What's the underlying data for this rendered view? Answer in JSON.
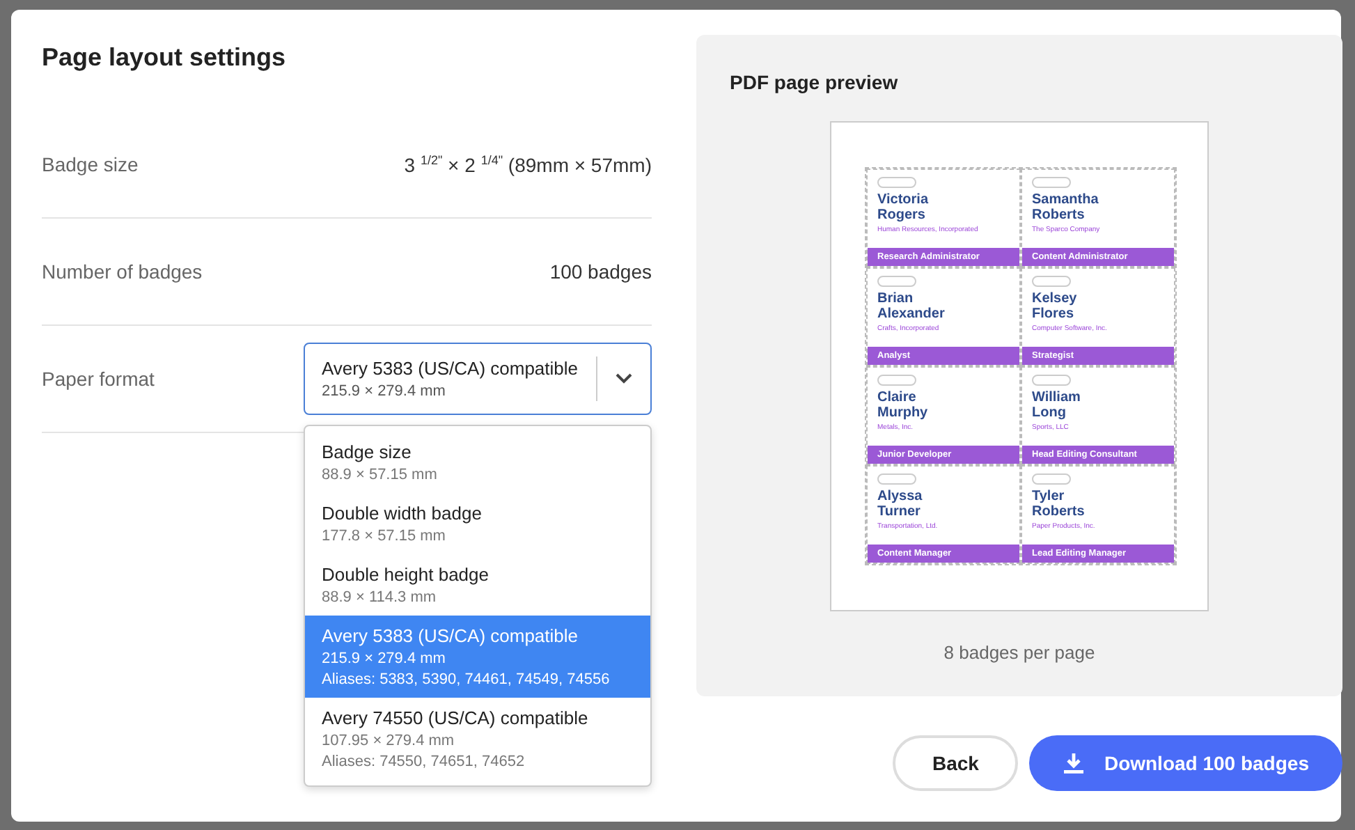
{
  "dialog": {
    "title": "Page layout settings",
    "settings": [
      {
        "label": "Badge size",
        "value": "3 $^{1/2\"}$ × 2 $^{1/4\"}$ (89mm × 57mm)"
      },
      {
        "label": "Number of badges",
        "value": "100 badges"
      }
    ],
    "paper_format": {
      "label": "Paper format",
      "value": "Avery 5383 (US/CA) compatible",
      "detail": "215.9 × 279.4 mm",
      "expanded": true,
      "options": [
        {
          "name": "Badge size",
          "size": "88.9 × 57.15 mm",
          "selected": false
        },
        {
          "name": "Double width badge",
          "size": "177.8 × 57.15 mm",
          "selected": false
        },
        {
          "name": "Double height badge",
          "size": "88.9 × 114.3 mm",
          "selected": false
        },
        {
          "name": "Avery 5383 (US/CA) compatible",
          "size": "215.9 × 279.4 mm",
          "aliases": "Aliases: 5383, 5390, 74461, 74549, 74556",
          "selected": true
        },
        {
          "name": "Avery 74550 (US/CA) compatible",
          "size": "107.95 × 279.4 mm",
          "aliases": "Aliases: 74550, 74651, 74652",
          "selected": false
        }
      ]
    },
    "preview": {
      "title": "PDF page preview",
      "badges": [
        {
          "first": "Victoria",
          "last": "Rogers",
          "company": "Human Resources, Incorporated",
          "role": "Research Administrator"
        },
        {
          "first": "Samantha",
          "last": "Roberts",
          "company": "The Sparco Company",
          "role": "Content Administrator"
        },
        {
          "first": "Brian",
          "last": "Alexander",
          "company": "Crafts, Incorporated",
          "role": "Analyst"
        },
        {
          "first": "Kelsey",
          "last": "Flores",
          "company": "Computer Software, Inc.",
          "role": "Strategist"
        },
        {
          "first": "Claire",
          "last": "Murphy",
          "company": "Metals, Inc.",
          "role": "Junior Developer"
        },
        {
          "first": "William",
          "last": "Long",
          "company": "Sports, LLC",
          "role": "Head Editing Consultant"
        },
        {
          "first": "Alyssa",
          "last": "Turner",
          "company": "Transportation, Ltd.",
          "role": "Content Manager"
        },
        {
          "first": "Tyler",
          "last": "Roberts",
          "company": "Paper Products, Inc.",
          "role": "Lead Editing Manager"
        }
      ],
      "caption": "8 badges per page"
    },
    "buttons": {
      "back": "Back",
      "download": "Download 100 badges"
    }
  }
}
